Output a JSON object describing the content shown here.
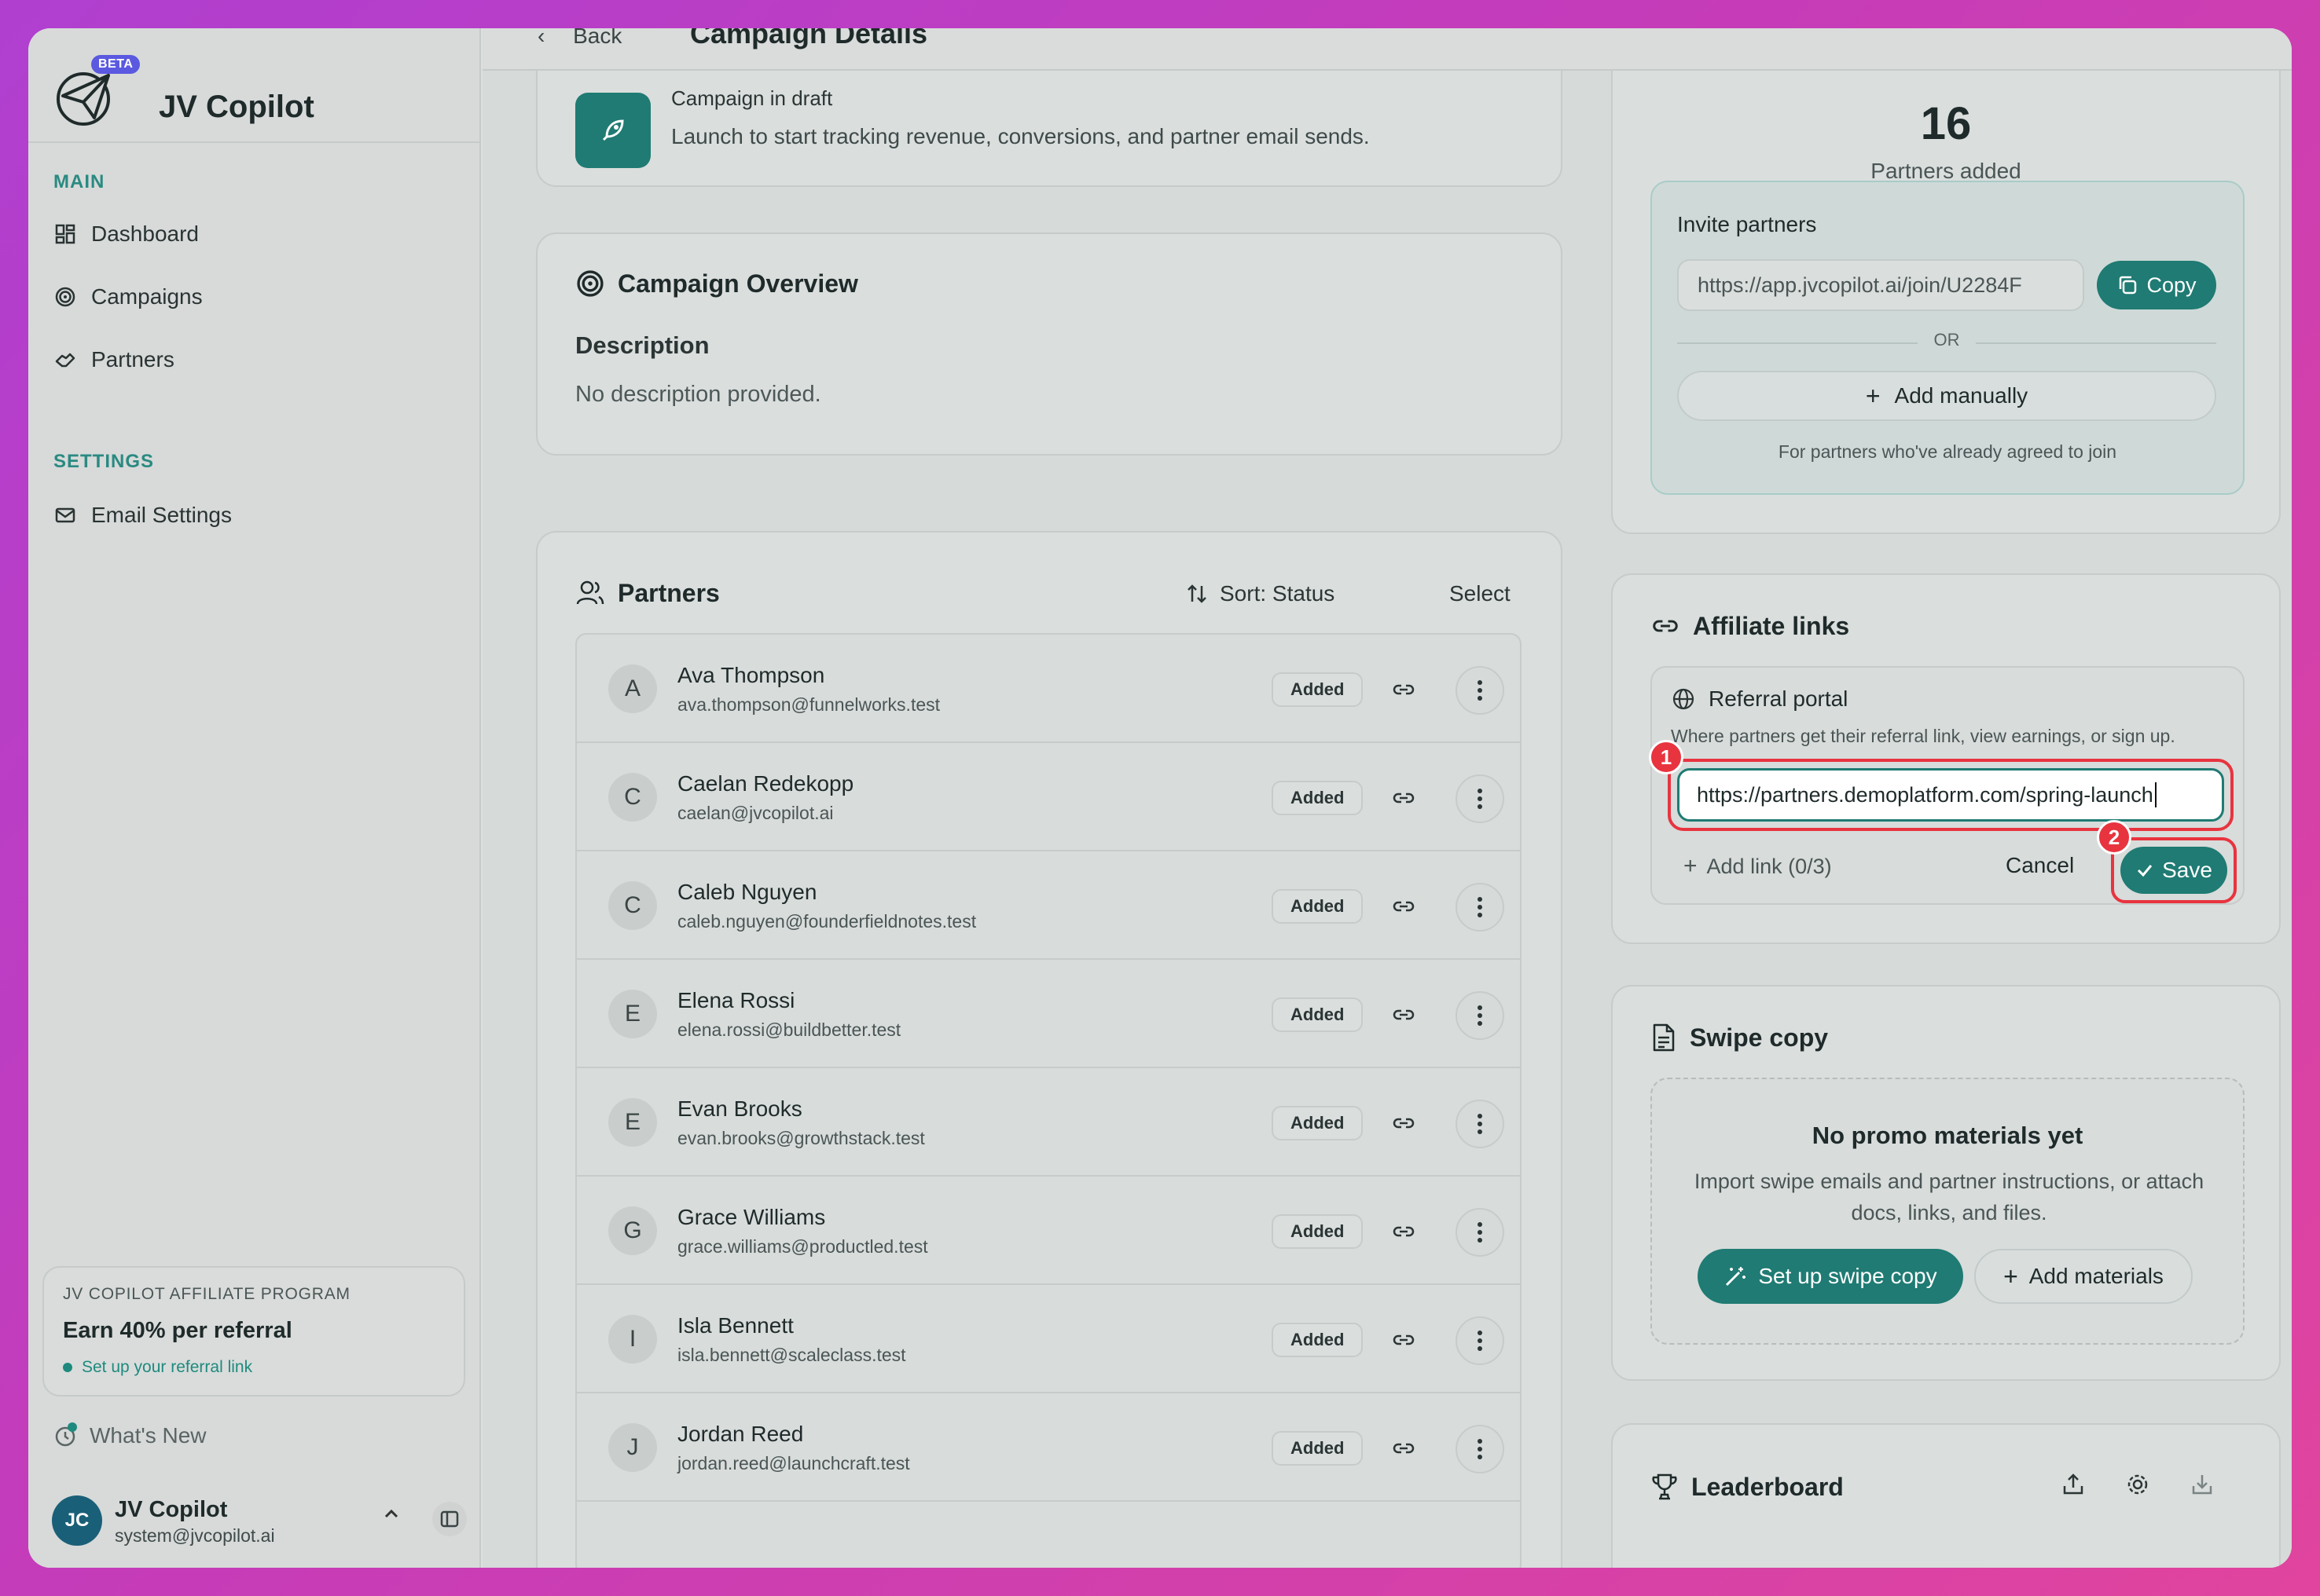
{
  "brand": {
    "name": "JV Copilot",
    "badge": "BETA"
  },
  "sidebar": {
    "main_label": "MAIN",
    "main_items": [
      {
        "label": "Dashboard",
        "icon": "dashboard-icon"
      },
      {
        "label": "Campaigns",
        "icon": "target-icon"
      },
      {
        "label": "Partners",
        "icon": "handshake-icon"
      }
    ],
    "settings_label": "SETTINGS",
    "settings_items": [
      {
        "label": "Email Settings",
        "icon": "mail-icon"
      }
    ],
    "promo": {
      "kicker": "JV COPILOT AFFILIATE PROGRAM",
      "title": "Earn 40% per referral",
      "link": "Set up your referral link"
    },
    "whats_new": "What's New",
    "user": {
      "initials": "JC",
      "name": "JV Copilot",
      "email": "system@jvcopilot.ai"
    }
  },
  "topbar": {
    "back": "Back",
    "title": "Campaign Details"
  },
  "draft": {
    "title": "Campaign in draft",
    "desc": "Launch to start tracking revenue, conversions, and partner email sends."
  },
  "overview": {
    "title": "Campaign Overview",
    "desc_label": "Description",
    "desc_text": "No description provided."
  },
  "partners": {
    "title": "Partners",
    "sort_label": "Sort: Status",
    "select_label": "Select",
    "rows": [
      {
        "initial": "A",
        "name": "Ava Thompson",
        "email": "ava.thompson@funnelworks.test",
        "status": "Added"
      },
      {
        "initial": "C",
        "name": "Caelan Redekopp",
        "email": "caelan@jvcopilot.ai",
        "status": "Added"
      },
      {
        "initial": "C",
        "name": "Caleb Nguyen",
        "email": "caleb.nguyen@founderfieldnotes.test",
        "status": "Added"
      },
      {
        "initial": "E",
        "name": "Elena Rossi",
        "email": "elena.rossi@buildbetter.test",
        "status": "Added"
      },
      {
        "initial": "E",
        "name": "Evan Brooks",
        "email": "evan.brooks@growthstack.test",
        "status": "Added"
      },
      {
        "initial": "G",
        "name": "Grace Williams",
        "email": "grace.williams@productled.test",
        "status": "Added"
      },
      {
        "initial": "I",
        "name": "Isla Bennett",
        "email": "isla.bennett@scaleclass.test",
        "status": "Added"
      },
      {
        "initial": "J",
        "name": "Jordan Reed",
        "email": "jordan.reed@launchcraft.test",
        "status": "Added"
      }
    ]
  },
  "stats": {
    "count": "16",
    "label": "Partners added"
  },
  "invite": {
    "title": "Invite partners",
    "url": "https://app.jvcopilot.ai/join/U2284F",
    "copy_label": "Copy",
    "or_label": "OR",
    "add_manually": "Add manually",
    "note": "For partners who've already agreed to join"
  },
  "affiliate": {
    "title": "Affiliate links",
    "portal_title": "Referral portal",
    "portal_sub": "Where partners get their referral link, view earnings, or sign up.",
    "input_value": "https://partners.demoplatform.com/spring-launch",
    "add_link": "Add link (0/3)",
    "cancel": "Cancel",
    "save": "Save",
    "marker1": "1",
    "marker2": "2"
  },
  "swipe": {
    "title": "Swipe copy",
    "empty_title": "No promo materials yet",
    "empty_desc": "Import swipe emails and partner instructions, or attach docs, links, and files.",
    "setup_btn": "Set up swipe copy",
    "add_btn": "Add materials"
  },
  "leaderboard": {
    "title": "Leaderboard"
  },
  "colors": {
    "accent": "#1f7b73",
    "marker": "#e8343f",
    "brand_badge": "#5b59e0"
  }
}
